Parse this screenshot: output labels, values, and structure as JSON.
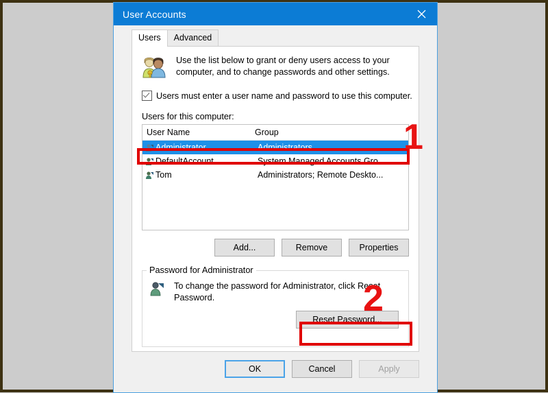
{
  "window": {
    "title": "User Accounts",
    "close_icon": "close-icon",
    "accent_color": "#0c7cd5"
  },
  "tabs": [
    {
      "label": "Users",
      "active": true
    },
    {
      "label": "Advanced",
      "active": false
    }
  ],
  "intro": {
    "icon": "users-group-icon",
    "text": "Use the list below to grant or deny users access to your computer, and to change passwords and other settings."
  },
  "require_login": {
    "label": "Users must enter a user name and password to use this computer.",
    "checked": true
  },
  "users_list": {
    "label": "Users for this computer:",
    "columns": [
      "User Name",
      "Group"
    ],
    "rows": [
      {
        "icon": "user-icon",
        "name": "Administrator",
        "group": "Administrators",
        "selected": true
      },
      {
        "icon": "user-icon",
        "name": "DefaultAccount",
        "group": "System Managed Accounts Gro...",
        "selected": false
      },
      {
        "icon": "user-icon",
        "name": "Tom",
        "group": "Administrators; Remote Deskto...",
        "selected": false
      }
    ]
  },
  "list_actions": {
    "add": "Add...",
    "remove": "Remove",
    "properties": "Properties"
  },
  "password_group": {
    "title": "Password for Administrator",
    "icon": "user-key-icon",
    "description": "To change the password for Administrator, click Reset Password.",
    "reset_button": "Reset Password..."
  },
  "footer": {
    "ok": "OK",
    "cancel": "Cancel",
    "apply": "Apply",
    "apply_disabled": true
  },
  "annotations": {
    "marker_color": "#e81313",
    "items": [
      {
        "number": "1",
        "target": "selected-user-row"
      },
      {
        "number": "2",
        "target": "reset-password-button"
      }
    ]
  }
}
